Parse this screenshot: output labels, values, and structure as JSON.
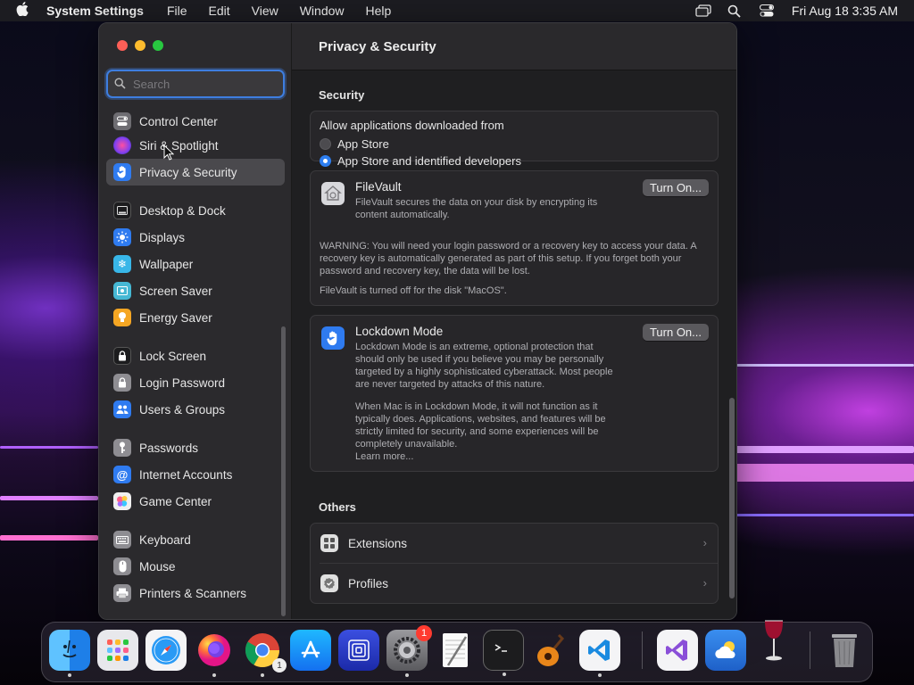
{
  "menubar": {
    "app_name": "System Settings",
    "items": [
      "File",
      "Edit",
      "View",
      "Window",
      "Help"
    ],
    "clock": "Fri Aug 18  3:35 AM"
  },
  "sidebar": {
    "search_placeholder": "Search",
    "items": [
      {
        "label": "Control Center",
        "icon": "control-center-icon",
        "color": "#6e6d72"
      },
      {
        "label": "Siri & Spotlight",
        "icon": "siri-icon",
        "color": "#b04adf"
      },
      {
        "label": "Privacy & Security",
        "icon": "hand-icon",
        "color": "#2f7bf0",
        "selected": true
      },
      {
        "label": "Desktop & Dock",
        "icon": "dock-icon",
        "color": "#1c1c1e"
      },
      {
        "label": "Displays",
        "icon": "sun-icon",
        "color": "#2f7bf0"
      },
      {
        "label": "Wallpaper",
        "icon": "snowflake-icon",
        "color": "#38b6e8"
      },
      {
        "label": "Screen Saver",
        "icon": "screen-saver-icon",
        "color": "#46b8d4"
      },
      {
        "label": "Energy Saver",
        "icon": "bulb-icon",
        "color": "#f5a623"
      },
      {
        "label": "Lock Screen",
        "icon": "lock-icon",
        "color": "#1c1c1e"
      },
      {
        "label": "Login Password",
        "icon": "lock-icon",
        "color": "#8e8d92"
      },
      {
        "label": "Users & Groups",
        "icon": "users-icon",
        "color": "#2f7bf0"
      },
      {
        "label": "Passwords",
        "icon": "key-icon",
        "color": "#8e8d92"
      },
      {
        "label": "Internet Accounts",
        "icon": "at-icon",
        "color": "#2f7bf0"
      },
      {
        "label": "Game Center",
        "icon": "game-center-icon",
        "color": "#f0f0f0"
      },
      {
        "label": "Keyboard",
        "icon": "keyboard-icon",
        "color": "#8e8d92"
      },
      {
        "label": "Mouse",
        "icon": "mouse-icon",
        "color": "#8e8d92"
      },
      {
        "label": "Printers & Scanners",
        "icon": "printer-icon",
        "color": "#8e8d92"
      }
    ]
  },
  "main": {
    "title": "Privacy & Security",
    "security_heading": "Security",
    "allow_label": "Allow applications downloaded from",
    "radio_app_store": "App Store",
    "radio_identified": "App Store and identified developers",
    "filevault": {
      "title": "FileVault",
      "desc": "FileVault secures the data on your disk by encrypting its content automatically.",
      "button": "Turn On...",
      "warning": "WARNING: You will need your login password or a recovery key to access your data. A recovery key is automatically generated as part of this setup. If you forget both your password and recovery key, the data will be lost.",
      "status": "FileVault is turned off for the disk \"MacOS\"."
    },
    "lockdown": {
      "title": "Lockdown Mode",
      "desc": "Lockdown Mode is an extreme, optional protection that should only be used if you believe you may be personally targeted by a highly sophisticated cyberattack. Most people are never targeted by attacks of this nature.",
      "desc2": "When Mac is in Lockdown Mode, it will not function as it typically does. Applications, websites, and features will be strictly limited for security, and some experiences will be completely unavailable.",
      "link": "Learn more...",
      "button": "Turn On..."
    },
    "others_heading": "Others",
    "others": [
      {
        "label": "Extensions",
        "icon": "extensions-icon"
      },
      {
        "label": "Profiles",
        "icon": "checkmark-badge-icon"
      }
    ]
  },
  "dock": {
    "apps": [
      "Finder",
      "Launchpad",
      "Safari",
      "Firefox",
      "Chrome",
      "App Store",
      "Screen Sharing",
      "System Settings",
      "TextEdit",
      "Terminal",
      "GarageBand",
      "Visual Studio Code",
      "Visual Studio",
      "Weather",
      "Wine",
      "Trash"
    ],
    "chrome_badge": "1",
    "settings_badge": "1"
  }
}
